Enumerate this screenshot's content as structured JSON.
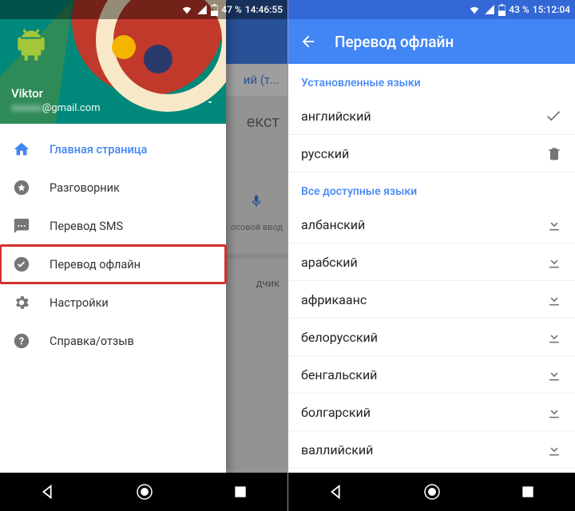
{
  "left": {
    "status": {
      "battery": "47 %",
      "time": "14:46:55"
    },
    "background": {
      "lang_partial": "ий (т...",
      "word": "екст",
      "mic_label": "осовой ввод",
      "caption": "дчик"
    },
    "profile": {
      "name": "Viktor",
      "email_suffix": "@gmail.com"
    },
    "menu": [
      {
        "label": "Главная страница"
      },
      {
        "label": "Разговорник"
      },
      {
        "label": "Перевод SMS"
      },
      {
        "label": "Перевод офлайн"
      },
      {
        "label": "Настройки"
      },
      {
        "label": "Справка/отзыв"
      }
    ]
  },
  "right": {
    "status": {
      "battery": "43 %",
      "time": "15:12:04"
    },
    "title": "Перевод офлайн",
    "section_installed": "Установленные языки",
    "section_available": "Все доступные языки",
    "installed": [
      {
        "name": "английский",
        "trail": "check"
      },
      {
        "name": "русский",
        "trail": "delete"
      }
    ],
    "available": [
      {
        "name": "албанский"
      },
      {
        "name": "арабский"
      },
      {
        "name": "африкаанс"
      },
      {
        "name": "белорусский"
      },
      {
        "name": "бенгальский"
      },
      {
        "name": "болгарский"
      },
      {
        "name": "валлийский"
      }
    ]
  }
}
